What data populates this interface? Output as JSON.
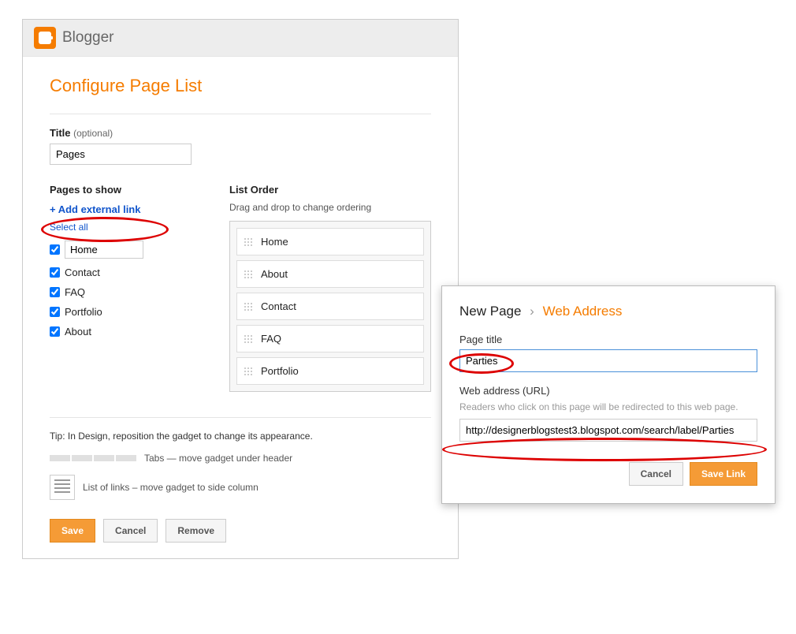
{
  "brand": "Blogger",
  "heading": "Configure Page List",
  "titleSection": {
    "label": "Title",
    "optional": "(optional)",
    "value": "Pages"
  },
  "pagesToShow": {
    "heading": "Pages to show",
    "addExternal": "+ Add external link",
    "selectAll": "Select all",
    "homeValue": "Home",
    "items": [
      "Contact",
      "FAQ",
      "Portfolio",
      "About"
    ]
  },
  "listOrder": {
    "heading": "List Order",
    "hint": "Drag and drop to change ordering",
    "items": [
      "Home",
      "About",
      "Contact",
      "FAQ",
      "Portfolio"
    ]
  },
  "tip": {
    "line": "Tip: In Design, reposition the gadget to change its appearance.",
    "tabs": "Tabs — move gadget under header",
    "links": "List of links – move gadget to side column"
  },
  "buttons": {
    "save": "Save",
    "cancel": "Cancel",
    "remove": "Remove"
  },
  "popup": {
    "newPage": "New Page",
    "webAddress": "Web Address",
    "pageTitleLabel": "Page title",
    "pageTitleValue": "Parties",
    "webLabel": "Web address (URL)",
    "webHint": "Readers who click on this page will be redirected to this web page.",
    "urlValue": "http://designerblogstest3.blogspot.com/search/label/Parties",
    "cancel": "Cancel",
    "saveLink": "Save Link"
  }
}
